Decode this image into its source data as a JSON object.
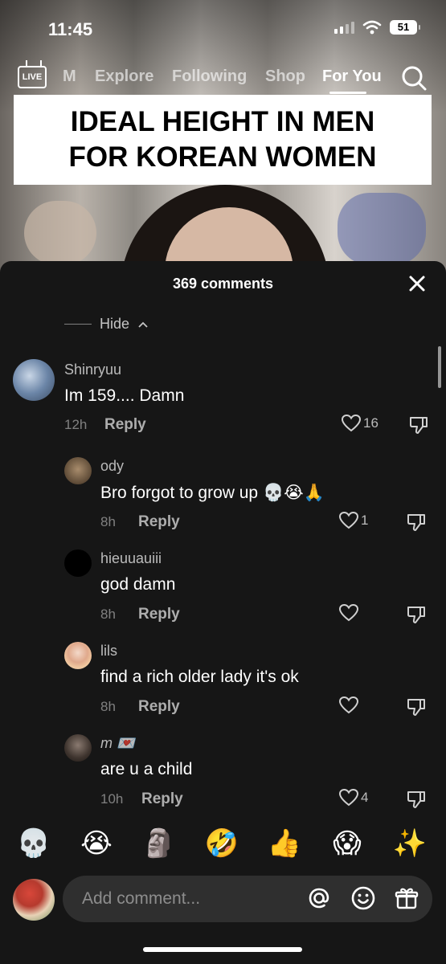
{
  "status_bar": {
    "time": "11:45",
    "battery": "51"
  },
  "top_nav": {
    "live_label": "LIVE",
    "tabs": [
      {
        "label": "M"
      },
      {
        "label": "Explore"
      },
      {
        "label": "Following"
      },
      {
        "label": "Shop"
      },
      {
        "label": "For You",
        "active": true
      }
    ]
  },
  "video": {
    "caption_line1": "IDEAL HEIGHT IN MEN",
    "caption_line2": "FOR KOREAN WOMEN"
  },
  "comments_panel": {
    "title": "369 comments",
    "hide_label": "Hide",
    "reply_label": "Reply",
    "comments": [
      {
        "user": "Shinryuu",
        "text": "Im 159.... Damn",
        "time": "12h",
        "likes": "16"
      },
      {
        "user": "ody",
        "text": "Bro forgot to grow up 💀😭🙏",
        "time": "8h",
        "likes": "1"
      },
      {
        "user": "hieuuauiii",
        "text": "god damn",
        "time": "8h",
        "likes": ""
      },
      {
        "user": "lils",
        "text": "find a rich older lady it's ok",
        "time": "8h",
        "likes": ""
      },
      {
        "user": "m 💌",
        "text": "are u a child",
        "time": "10h",
        "likes": "4"
      }
    ]
  },
  "emoji_bar": [
    "💀",
    "😭",
    "🗿",
    "🤣",
    "👍",
    "😱",
    "✨"
  ],
  "composer": {
    "placeholder": "Add comment..."
  },
  "colors": {
    "sheet_bg": "#161616",
    "input_bg": "#2f2f2f",
    "caption_bg": "#ffffff"
  }
}
